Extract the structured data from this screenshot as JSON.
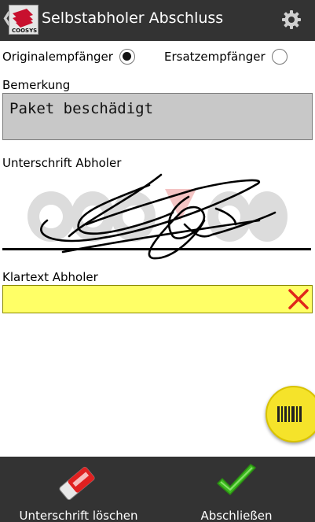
{
  "header": {
    "back_icon": "chevron-left-icon",
    "logo": "coosys-logo",
    "title": "Selbstabholer Abschluss",
    "settings_icon": "gear-icon"
  },
  "recipient": {
    "options": [
      {
        "label": "Originalempfänger",
        "checked": true
      },
      {
        "label": "Ersatzempfänger",
        "checked": false
      }
    ]
  },
  "remark": {
    "label": "Bemerkung",
    "value": "Paket beschädigt"
  },
  "signature": {
    "label": "Unterschrift Abholer"
  },
  "klartext": {
    "label": "Klartext Abholer",
    "value": "",
    "clear_icon": "clear-x-icon",
    "color": "#ffff66"
  },
  "scan_button": {
    "icon": "barcode-icon",
    "color": "#f5e32a"
  },
  "footer": {
    "clear_signature_label": "Unterschrift löschen",
    "clear_signature_icon": "eraser-icon",
    "finish_label": "Abschließen",
    "finish_icon": "checkmark-icon"
  },
  "colors": {
    "bar": "#333333",
    "checkmark": "#3cba1f",
    "clear_x": "#e0261b"
  }
}
